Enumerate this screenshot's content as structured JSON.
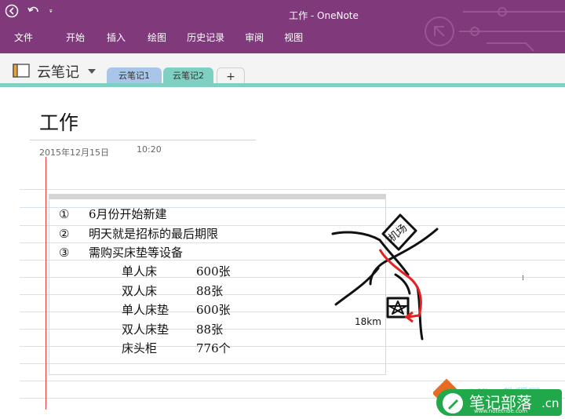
{
  "window": {
    "title": "工作 - OneNote"
  },
  "ribbon": {
    "tabs": [
      "文件",
      "开始",
      "插入",
      "绘图",
      "历史记录",
      "审阅",
      "视图"
    ]
  },
  "notebook": {
    "name": "云笔记",
    "sections": [
      "云笔记1",
      "云笔记2"
    ],
    "active_section": 1,
    "add_label": "+"
  },
  "page": {
    "title": "工作",
    "date": "2015年12月15日",
    "time": "10:20",
    "items": [
      {
        "num": "①",
        "text": "6月份开始新建"
      },
      {
        "num": "②",
        "text": "明天就是招标的最后期限"
      },
      {
        "num": "③",
        "text": "需购买床垫等设备"
      }
    ],
    "equipment": [
      {
        "name": "单人床",
        "qty": "600张"
      },
      {
        "name": "双人床",
        "qty": "88张"
      },
      {
        "name": "单人床垫",
        "qty": "600张"
      },
      {
        "name": "双人床垫",
        "qty": "88张"
      },
      {
        "name": "床头柜",
        "qty": "776个"
      }
    ],
    "drawing": {
      "label1": "机场",
      "label2": "18km"
    }
  },
  "watermark": {
    "text": "笔记部落",
    "domain": ".cn",
    "sub": "www.notetribe.com",
    "office": "Office教程网"
  },
  "colors": {
    "titlebar": "#80397b",
    "section_tab_1": "#a9c6e8",
    "section_tab_2": "#7fcfc2",
    "red_line": "#e23a3a"
  }
}
